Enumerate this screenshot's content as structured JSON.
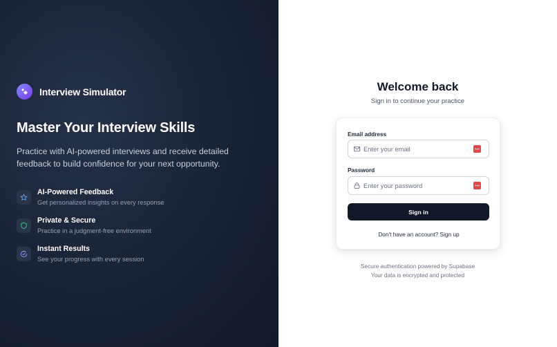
{
  "brand": {
    "name": "Interview Simulator",
    "logo_icon": "sparkle-icon",
    "accent": "#7c3aed"
  },
  "hero": {
    "headline": "Master Your Interview Skills",
    "tagline": "Practice with AI-powered interviews and receive detailed feedback to build confidence for your next opportunity."
  },
  "features": [
    {
      "icon": "star-icon",
      "icon_color": "#60a5fa",
      "title": "AI-Powered Feedback",
      "description": "Get personalized insights on every response"
    },
    {
      "icon": "shield-icon",
      "icon_color": "#34d399",
      "title": "Private & Secure",
      "description": "Practice in a judgment-free environment"
    },
    {
      "icon": "check-circle-icon",
      "icon_color": "#a78bfa",
      "title": "Instant Results",
      "description": "See your progress with every session"
    }
  ],
  "login": {
    "title": "Welcome back",
    "subtitle": "Sign in to continue your practice",
    "email": {
      "label": "Email address",
      "placeholder": "Enter your email",
      "value": "",
      "icon": "mail-icon"
    },
    "password": {
      "label": "Password",
      "placeholder": "Enter your password",
      "value": "",
      "icon": "lock-icon"
    },
    "password_manager_icon": "password-manager-icon",
    "submit_label": "Sign in",
    "signup_prompt": "Don't have an account? Sign up",
    "button_color": "#111827"
  },
  "footer": {
    "line1": "Secure authentication powered by Supabase",
    "line2": "Your data is encrypted and protected"
  }
}
